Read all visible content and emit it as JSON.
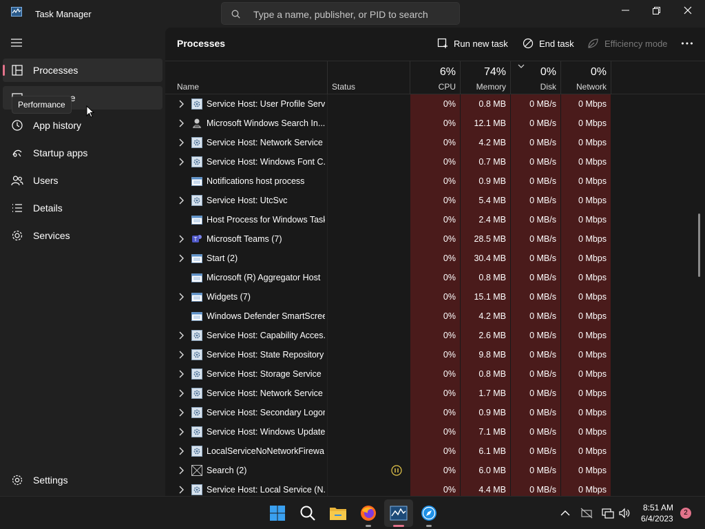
{
  "window": {
    "title": "Task Manager",
    "search_placeholder": "Type a name, publisher, or PID to search"
  },
  "sidebar": {
    "items": [
      {
        "label": "Processes",
        "icon": "processes-icon"
      },
      {
        "label": "Performance",
        "icon": "performance-icon",
        "visible_text": "nce"
      },
      {
        "label": "App history",
        "icon": "app-history-icon"
      },
      {
        "label": "Startup apps",
        "icon": "startup-apps-icon"
      },
      {
        "label": "Users",
        "icon": "users-icon"
      },
      {
        "label": "Details",
        "icon": "details-icon"
      },
      {
        "label": "Services",
        "icon": "services-icon"
      }
    ],
    "settings_label": "Settings",
    "tooltip": "Performance"
  },
  "main": {
    "title": "Processes",
    "toolbar": {
      "run_new_task": "Run new task",
      "end_task": "End task",
      "efficiency_mode": "Efficiency mode"
    },
    "columns": {
      "name": "Name",
      "status": "Status",
      "cpu_pct": "6%",
      "cpu": "CPU",
      "memory_pct": "74%",
      "memory": "Memory",
      "disk_pct": "0%",
      "disk": "Disk",
      "network_pct": "0%",
      "network": "Network"
    },
    "rows": [
      {
        "name": "Service Host: User Profile Servi...",
        "expand": true,
        "icon": "gear",
        "cpu": "0%",
        "memory": "0.8 MB",
        "disk": "0 MB/s",
        "network": "0 Mbps"
      },
      {
        "name": "Microsoft Windows Search In...",
        "expand": true,
        "icon": "search-indexer",
        "cpu": "0%",
        "memory": "12.1 MB",
        "disk": "0 MB/s",
        "network": "0 Mbps"
      },
      {
        "name": "Service Host: Network Service",
        "expand": true,
        "icon": "gear",
        "cpu": "0%",
        "memory": "4.2 MB",
        "disk": "0 MB/s",
        "network": "0 Mbps"
      },
      {
        "name": "Service Host: Windows Font C...",
        "expand": true,
        "icon": "gear",
        "cpu": "0%",
        "memory": "0.7 MB",
        "disk": "0 MB/s",
        "network": "0 Mbps"
      },
      {
        "name": "Notifications host process",
        "expand": false,
        "icon": "window",
        "cpu": "0%",
        "memory": "0.9 MB",
        "disk": "0 MB/s",
        "network": "0 Mbps"
      },
      {
        "name": "Service Host: UtcSvc",
        "expand": true,
        "icon": "gear",
        "cpu": "0%",
        "memory": "5.4 MB",
        "disk": "0 MB/s",
        "network": "0 Mbps"
      },
      {
        "name": "Host Process for Windows Tasks",
        "expand": false,
        "icon": "window",
        "cpu": "0%",
        "memory": "2.4 MB",
        "disk": "0 MB/s",
        "network": "0 Mbps"
      },
      {
        "name": "Microsoft Teams (7)",
        "expand": true,
        "icon": "teams",
        "cpu": "0%",
        "memory": "28.5 MB",
        "disk": "0 MB/s",
        "network": "0 Mbps"
      },
      {
        "name": "Start (2)",
        "expand": true,
        "icon": "window",
        "cpu": "0%",
        "memory": "30.4 MB",
        "disk": "0 MB/s",
        "network": "0 Mbps"
      },
      {
        "name": "Microsoft (R) Aggregator Host",
        "expand": false,
        "icon": "window",
        "cpu": "0%",
        "memory": "0.8 MB",
        "disk": "0 MB/s",
        "network": "0 Mbps"
      },
      {
        "name": "Widgets (7)",
        "expand": true,
        "icon": "window",
        "cpu": "0%",
        "memory": "15.1 MB",
        "disk": "0 MB/s",
        "network": "0 Mbps"
      },
      {
        "name": "Windows Defender SmartScreen",
        "expand": false,
        "icon": "window",
        "cpu": "0%",
        "memory": "4.2 MB",
        "disk": "0 MB/s",
        "network": "0 Mbps"
      },
      {
        "name": "Service Host: Capability Acces...",
        "expand": true,
        "icon": "gear",
        "cpu": "0%",
        "memory": "2.6 MB",
        "disk": "0 MB/s",
        "network": "0 Mbps"
      },
      {
        "name": "Service Host: State Repository ...",
        "expand": true,
        "icon": "gear",
        "cpu": "0%",
        "memory": "9.8 MB",
        "disk": "0 MB/s",
        "network": "0 Mbps"
      },
      {
        "name": "Service Host: Storage Service",
        "expand": true,
        "icon": "gear",
        "cpu": "0%",
        "memory": "0.8 MB",
        "disk": "0 MB/s",
        "network": "0 Mbps"
      },
      {
        "name": "Service Host: Network Service",
        "expand": true,
        "icon": "gear",
        "cpu": "0%",
        "memory": "1.7 MB",
        "disk": "0 MB/s",
        "network": "0 Mbps"
      },
      {
        "name": "Service Host: Secondary Logon",
        "expand": true,
        "icon": "gear",
        "cpu": "0%",
        "memory": "0.9 MB",
        "disk": "0 MB/s",
        "network": "0 Mbps"
      },
      {
        "name": "Service Host: Windows Update",
        "expand": true,
        "icon": "gear",
        "cpu": "0%",
        "memory": "7.1 MB",
        "disk": "0 MB/s",
        "network": "0 Mbps"
      },
      {
        "name": "LocalServiceNoNetworkFirewa...",
        "expand": true,
        "icon": "gear",
        "cpu": "0%",
        "memory": "6.1 MB",
        "disk": "0 MB/s",
        "network": "0 Mbps"
      },
      {
        "name": "Search (2)",
        "expand": true,
        "icon": "search-app",
        "suspended": true,
        "cpu": "0%",
        "memory": "6.0 MB",
        "disk": "0 MB/s",
        "network": "0 Mbps"
      },
      {
        "name": "Service Host: Local Service (N...",
        "expand": true,
        "icon": "gear",
        "cpu": "0%",
        "memory": "4.4 MB",
        "disk": "0 MB/s",
        "network": "0 Mbps"
      }
    ]
  },
  "taskbar": {
    "icons": [
      "windows-start-icon",
      "search-icon",
      "file-explorer-icon",
      "firefox-icon",
      "task-manager-icon",
      "safari-like-app-icon"
    ],
    "clock_time": "8:51 AM",
    "clock_date": "6/4/2023",
    "notification_count": "2"
  },
  "colors": {
    "accent": "#e3738b",
    "heat_cell": "#4a1b1b",
    "background": "#191919",
    "sidebar": "#202020"
  }
}
